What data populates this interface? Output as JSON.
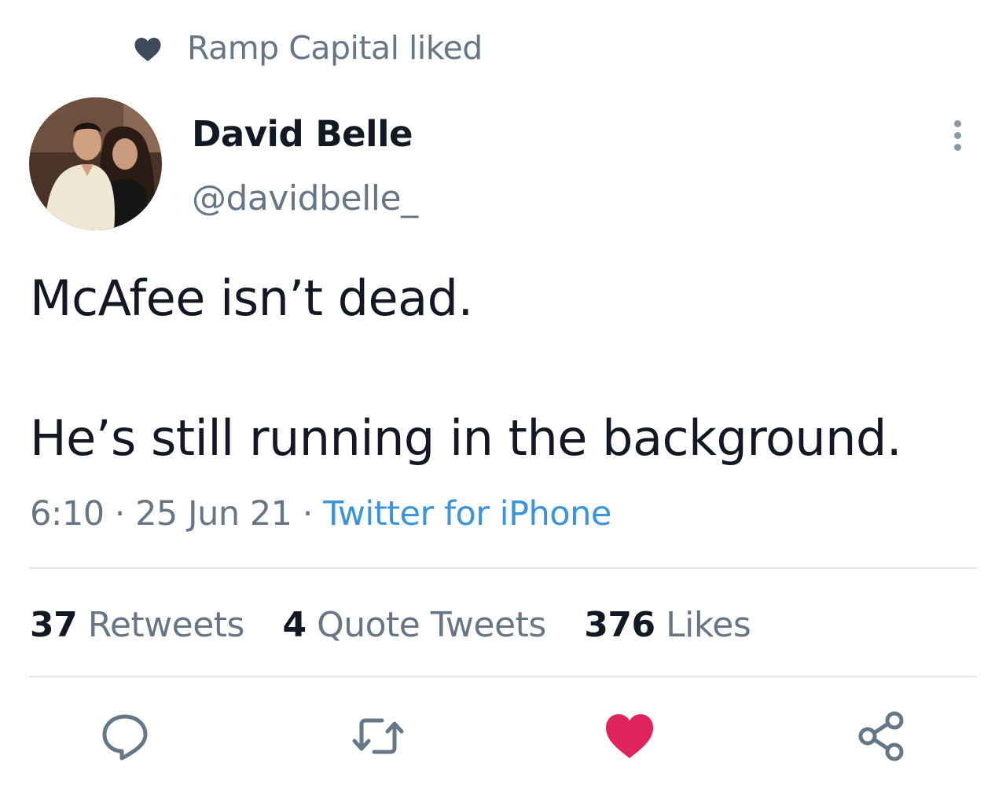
{
  "social_context": {
    "text": "Ramp Capital liked",
    "icon": "heart-icon"
  },
  "author": {
    "display_name": "David Belle",
    "handle": "@davidbelle_",
    "avatar": "profile-photo"
  },
  "tweet": {
    "line1": "McAfee isn’t dead.",
    "line2": "He’s still running in the background."
  },
  "meta": {
    "time": "6:10",
    "separator": "·",
    "date": "25 Jun 21",
    "source": "Twitter for iPhone"
  },
  "stats": [
    {
      "count": "37",
      "label": "Retweets"
    },
    {
      "count": "4",
      "label": "Quote Tweets"
    },
    {
      "count": "376",
      "label": "Likes"
    }
  ],
  "actions": [
    {
      "name": "reply",
      "icon": "comment-icon"
    },
    {
      "name": "retweet",
      "icon": "retweet-icon"
    },
    {
      "name": "like",
      "icon": "heart-icon",
      "active": true
    },
    {
      "name": "share",
      "icon": "share-icon"
    }
  ],
  "colors": {
    "text": "#141823",
    "muted": "#687684",
    "link": "#3b94d9",
    "like_active": "#e0245e",
    "divider": "#e1e8ed"
  }
}
